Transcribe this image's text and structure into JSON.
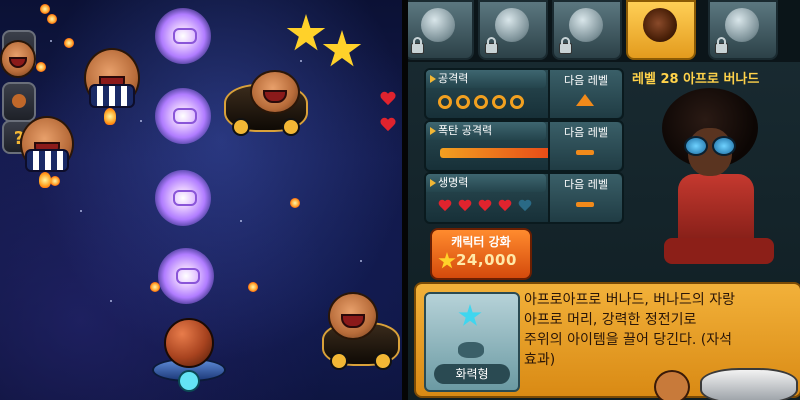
{
  "game": {
    "icons": [
      "character-portrait-icon",
      "bomb-icon",
      "help-icon"
    ],
    "help_glyph": "?",
    "colors": {
      "space": "#131a4a",
      "fireball": "#ff7a00",
      "ghost": "#b07cff",
      "star": "#ffd12a",
      "heart": "#e0232e"
    }
  },
  "upgrade": {
    "characters": [
      {
        "name": "character-1",
        "locked": true
      },
      {
        "name": "character-2",
        "locked": true
      },
      {
        "name": "character-3",
        "locked": true
      },
      {
        "name": "afro-bernard",
        "locked": false,
        "selected": true
      },
      {
        "name": "character-5",
        "locked": true
      }
    ],
    "level_title": "레벨 28 아프로 버나드",
    "stats": [
      {
        "label": "공격력",
        "kind": "rings",
        "value": 5,
        "next_label": "다음 레벨",
        "next_icon": "arrow-up-icon"
      },
      {
        "label": "폭탄 공격력",
        "kind": "bar",
        "value": 1.0,
        "next_label": "다음 레벨",
        "next_icon": "dash-icon"
      },
      {
        "label": "생명력",
        "kind": "hearts",
        "value": 4,
        "max": 5,
        "next_label": "다음 레벨",
        "next_icon": "dash-icon"
      }
    ],
    "button": {
      "label": "캐릭터 강화",
      "cost": "24,000"
    },
    "type_label": "화력형",
    "description_lines": [
      "아프로아프로 버나드, 버나드의 자랑",
      "아프로 머리, 강력한 정전기로",
      "주위의 아이템을 끌어 당긴다. (자석",
      "효과)"
    ],
    "colors": {
      "accent": "#ffd24a",
      "panel": "#1a2c33",
      "button": "#ff8b2e",
      "desc_bg": "#f2b13a"
    }
  }
}
